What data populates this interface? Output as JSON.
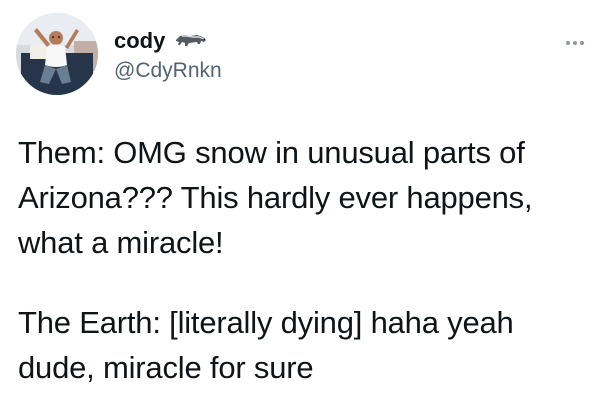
{
  "author": {
    "display_name": "cody",
    "handle": "@CdyRnkn",
    "name_icon": "badger-icon",
    "avatar_icon": "avatar-photo"
  },
  "menu": {
    "icon": "more-options-icon"
  },
  "tweet": {
    "paragraphs": [
      "Them: OMG snow in unusual parts of\nArizona??? This hardly ever happens,\nwhat a miracle!",
      "The Earth: [literally dying] haha yeah\ndude, miracle for sure"
    ]
  },
  "colors": {
    "text": "#0f1419",
    "secondary_text": "#536471",
    "background": "#ffffff"
  }
}
